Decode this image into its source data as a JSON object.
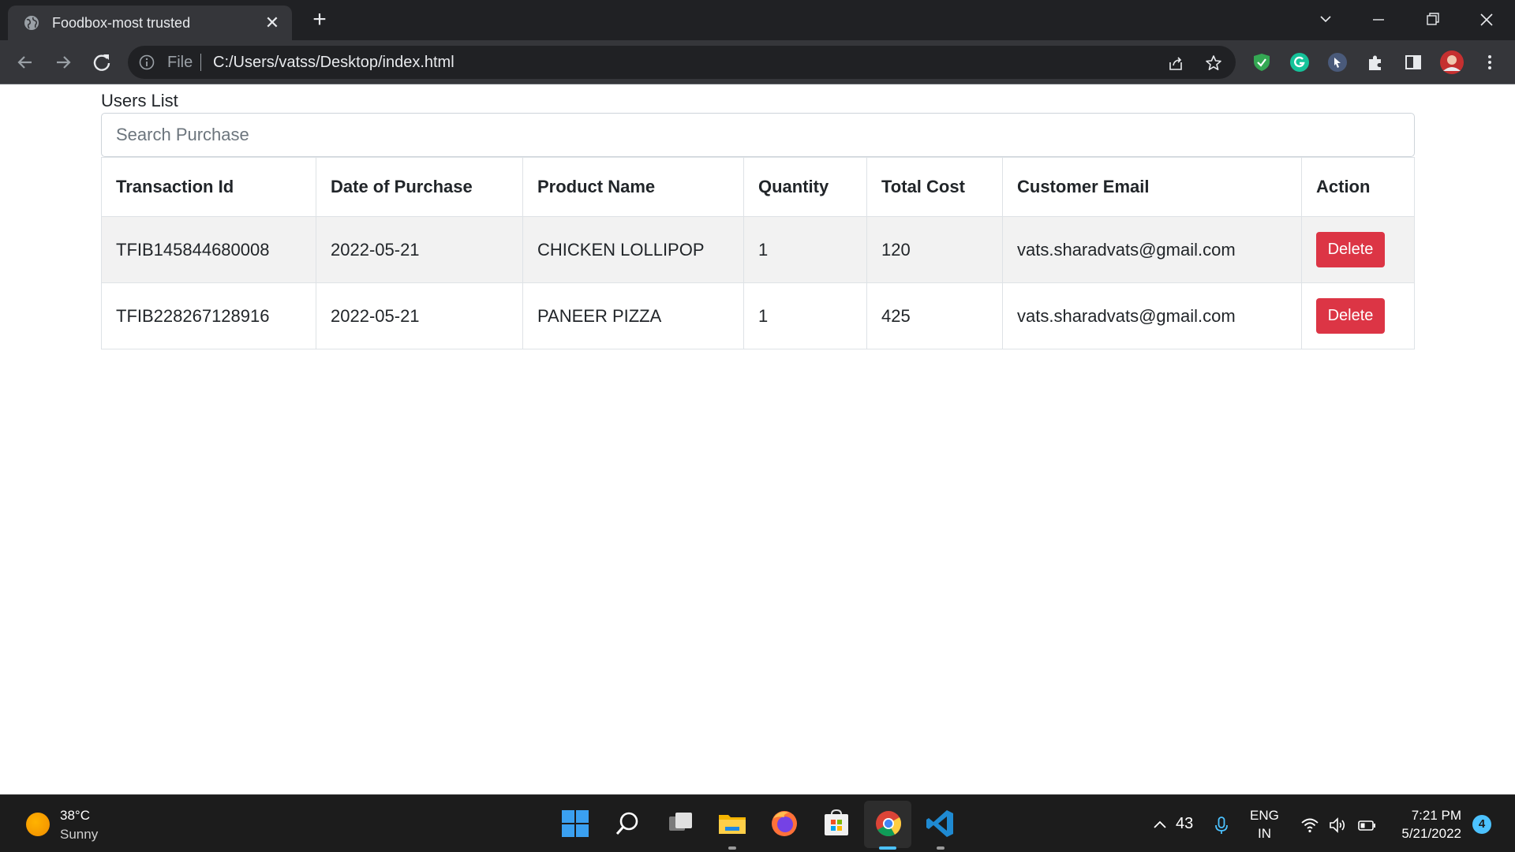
{
  "browser": {
    "tab_title": "Foodbox-most trusted",
    "omnibox_scheme": "File",
    "url": "C:/Users/vatss/Desktop/index.html"
  },
  "page": {
    "heading": "Users List",
    "search_placeholder": "Search Purchase",
    "columns": [
      "Transaction Id",
      "Date of Purchase",
      "Product Name",
      "Quantity",
      "Total Cost",
      "Customer Email",
      "Action"
    ],
    "rows": [
      {
        "transaction_id": "TFIB145844680008",
        "date": "2022-05-21",
        "product": "CHICKEN LOLLIPOP",
        "quantity": "1",
        "total_cost": "120",
        "email": "vats.sharadvats@gmail.com",
        "action": "Delete"
      },
      {
        "transaction_id": "TFIB228267128916",
        "date": "2022-05-21",
        "product": "PANEER PIZZA",
        "quantity": "1",
        "total_cost": "425",
        "email": "vats.sharadvats@gmail.com",
        "action": "Delete"
      }
    ],
    "delete_color": "#dc3545"
  },
  "taskbar": {
    "temperature": "38°C",
    "condition": "Sunny",
    "tray_count": "43",
    "lang_line1": "ENG",
    "lang_line2": "IN",
    "time": "7:21 PM",
    "date": "5/21/2022",
    "notifications": "4",
    "apps": [
      "start-icon",
      "search-icon",
      "task-view-icon",
      "file-explorer-icon",
      "firefox-icon",
      "store-icon",
      "chrome-icon",
      "vscode-icon"
    ]
  }
}
